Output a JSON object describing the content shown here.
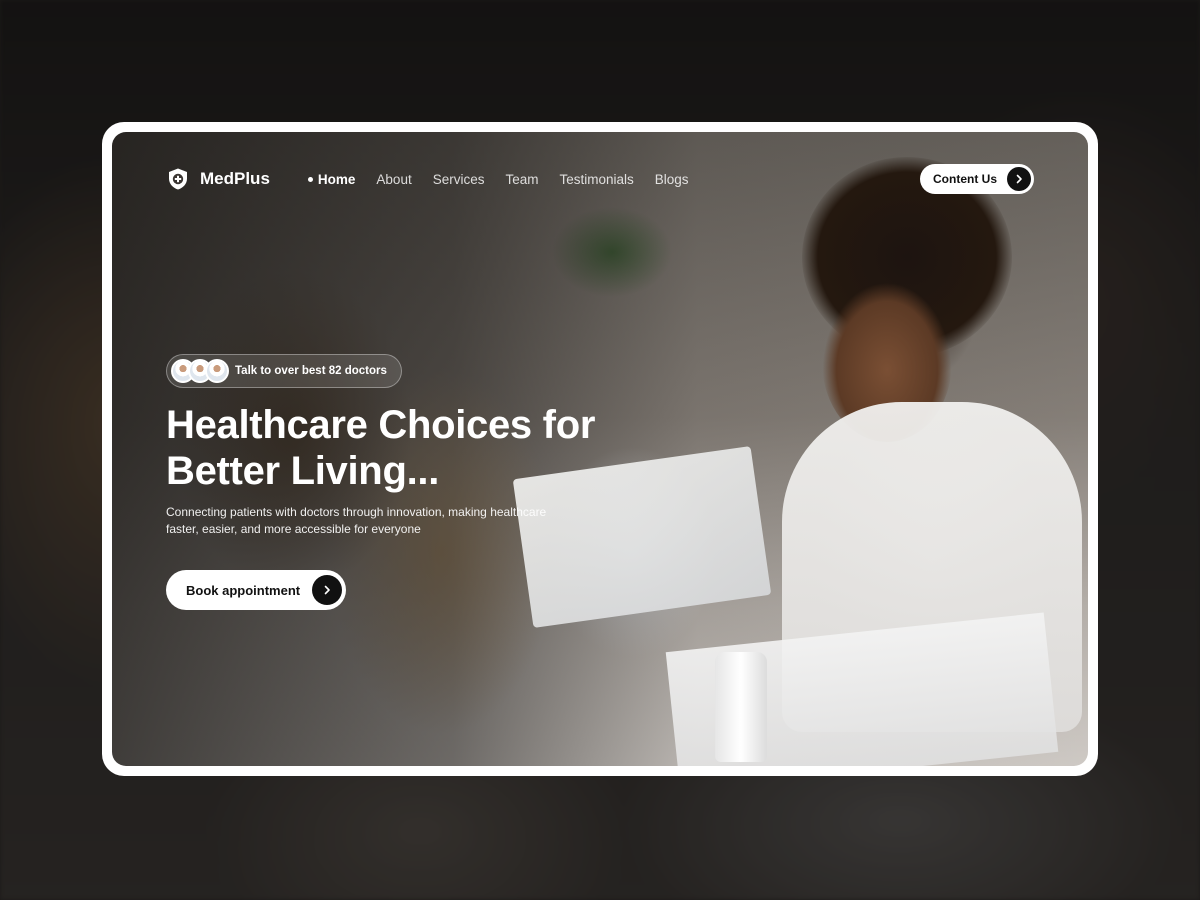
{
  "brand": {
    "name": "MedPlus",
    "icon": "shield-plus-icon"
  },
  "nav": {
    "items": [
      {
        "label": "Home",
        "active": true
      },
      {
        "label": "About",
        "active": false
      },
      {
        "label": "Services",
        "active": false
      },
      {
        "label": "Team",
        "active": false
      },
      {
        "label": "Testimonials",
        "active": false
      },
      {
        "label": "Blogs",
        "active": false
      }
    ],
    "cta_label": "Content Us",
    "cta_icon": "chevron-right-icon"
  },
  "hero": {
    "badge_text": "Talk to over best 82 doctors",
    "headline": "Healthcare Choices for Better Living...",
    "subtext": "Connecting patients with doctors through innovation, making healthcare faster, easier, and more accessible for everyone",
    "button_label": "Book appointment",
    "button_icon": "chevron-right-icon"
  },
  "colors": {
    "accent_dark": "#111111",
    "button_bg": "#ffffff",
    "text_light": "#ffffff"
  }
}
